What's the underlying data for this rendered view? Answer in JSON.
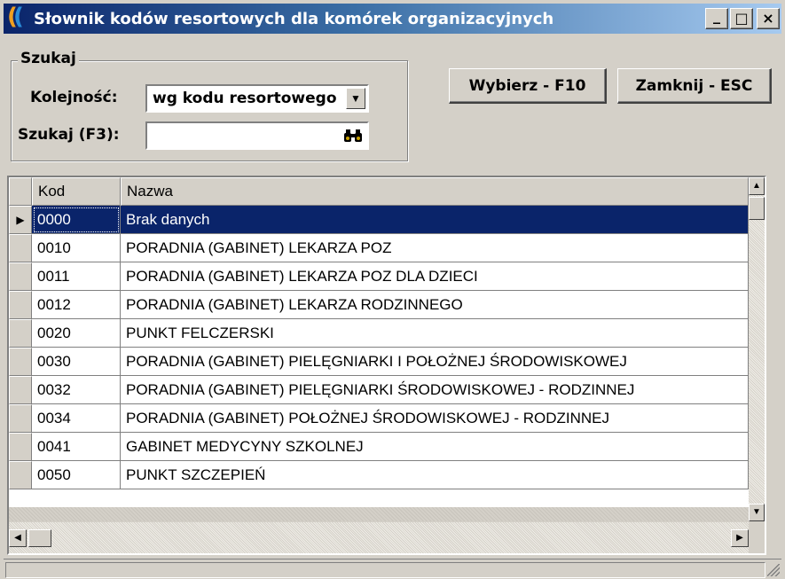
{
  "window": {
    "title": "Słownik kodów resortowych dla komórek organizacyjnych",
    "minimize_label": "_",
    "maximize_label": "□",
    "close_label": "×"
  },
  "search": {
    "group_label": "Szukaj",
    "order_label": "Kolejność:",
    "order_value": "wg kodu resortowego",
    "search_label": "Szukaj (F3):",
    "search_value": "",
    "search_icon": "binoculars-icon"
  },
  "buttons": {
    "select_label": "Wybierz - F10",
    "close_label": "Zamknij - ESC"
  },
  "grid": {
    "columns": [
      "Kod",
      "Nazwa"
    ],
    "rows": [
      {
        "kod": "0000",
        "nazwa": "Brak danych"
      },
      {
        "kod": "0010",
        "nazwa": "PORADNIA (GABINET) LEKARZA POZ"
      },
      {
        "kod": "0011",
        "nazwa": "PORADNIA (GABINET) LEKARZA POZ DLA DZIECI"
      },
      {
        "kod": "0012",
        "nazwa": "PORADNIA (GABINET) LEKARZA RODZINNEGO"
      },
      {
        "kod": "0020",
        "nazwa": "PUNKT FELCZERSKI"
      },
      {
        "kod": "0030",
        "nazwa": "PORADNIA (GABINET) PIELĘGNIARKI I POŁOŻNEJ ŚRODOWISKOWEJ"
      },
      {
        "kod": "0032",
        "nazwa": "PORADNIA (GABINET) PIELĘGNIARKI ŚRODOWISKOWEJ - RODZINNEJ"
      },
      {
        "kod": "0034",
        "nazwa": "PORADNIA (GABINET) POŁOŻNEJ ŚRODOWISKOWEJ - RODZINNEJ"
      },
      {
        "kod": "0041",
        "nazwa": "GABINET MEDYCYNY SZKOLNEJ"
      },
      {
        "kod": "0050",
        "nazwa": "PUNKT SZCZEPIEŃ"
      }
    ],
    "selected_index": 0
  },
  "colors": {
    "selection": "#0a246a",
    "face": "#d4d0c8"
  }
}
